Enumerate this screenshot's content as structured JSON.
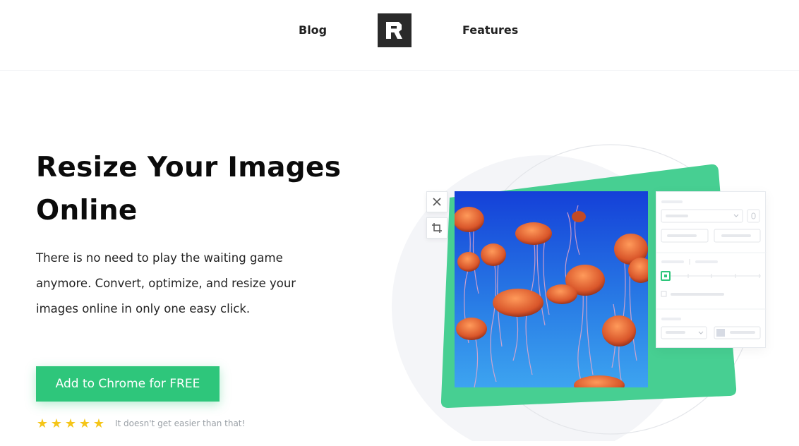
{
  "header": {
    "nav_left": "Blog",
    "nav_right": "Features",
    "logo_letter": "R"
  },
  "hero": {
    "title": "Resize Your Images Online",
    "description": "There is no need to play the waiting game anymore. Convert, optimize, and resize your images online in only one easy click.",
    "cta_label": "Add to Chrome for FREE",
    "rating_stars": 5,
    "rating_text": "It doesn't get easier than that!"
  },
  "illustration": {
    "tools": [
      "close-icon",
      "crop-icon"
    ],
    "colors": {
      "accent": "#2ec67b",
      "card": "#4ccf94",
      "sky": "#1f5ad8",
      "jelly": "#e0703a"
    }
  },
  "colors": {
    "accent": "#2ec67b",
    "star": "#f5c518",
    "muted_text": "#9aa0a6"
  }
}
